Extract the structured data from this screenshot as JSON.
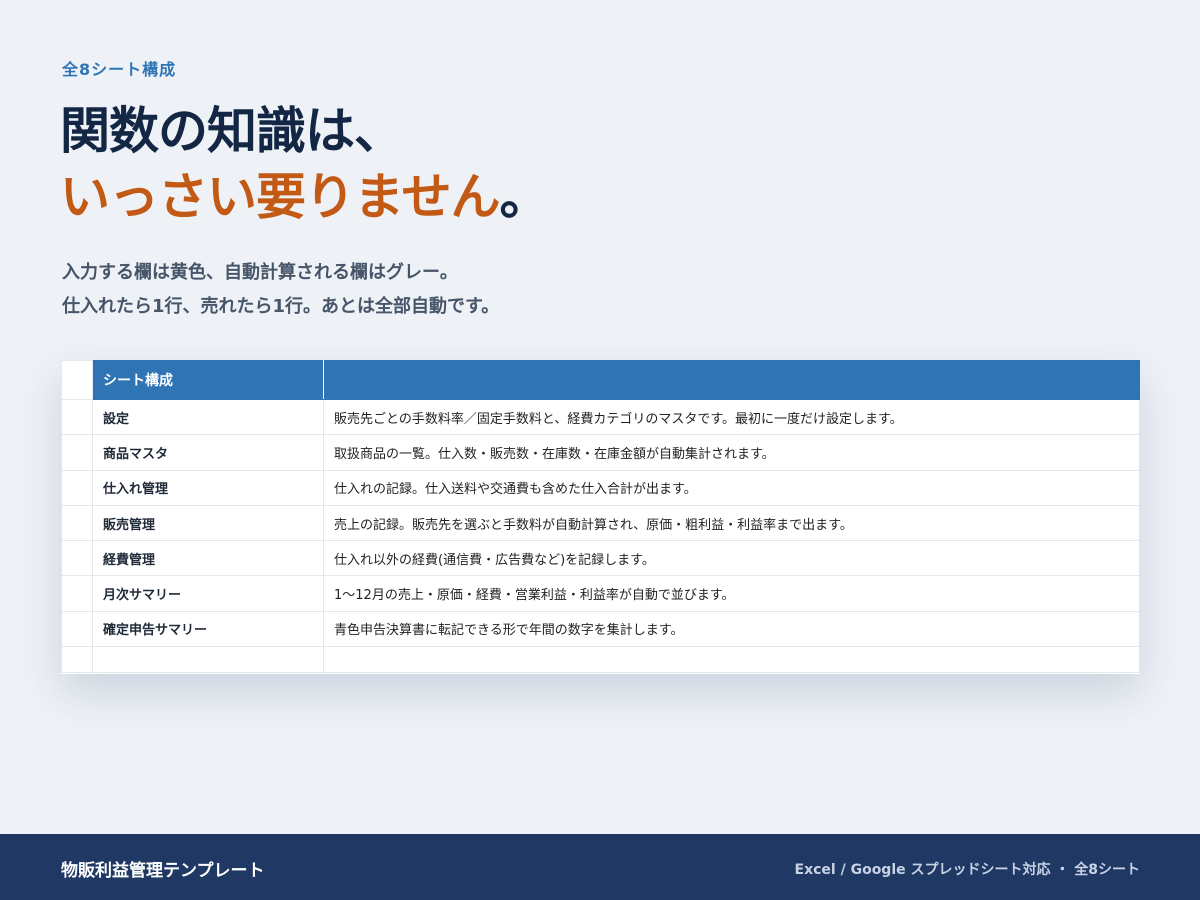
{
  "eyebrow": "全8シート構成",
  "headline": {
    "line1": "関数の知識は、",
    "line2_accent": "いっさい要りません",
    "line2_punct": "。"
  },
  "lead": {
    "line1": "入力する欄は黄色、自動計算される欄はグレー。",
    "line2": "仕入れたら1行、売れたら1行。あとは全部自動です。"
  },
  "sheet": {
    "header": "シート構成",
    "header_desc": "",
    "rows": [
      {
        "name": "設定",
        "desc": "販売先ごとの手数料率／固定手数料と、経費カテゴリのマスタです。最初に一度だけ設定します。"
      },
      {
        "name": "商品マスタ",
        "desc": "取扱商品の一覧。仕入数・販売数・在庫数・在庫金額が自動集計されます。"
      },
      {
        "name": "仕入れ管理",
        "desc": "仕入れの記録。仕入送料や交通費も含めた仕入合計が出ます。"
      },
      {
        "name": "販売管理",
        "desc": "売上の記録。販売先を選ぶと手数料が自動計算され、原価・粗利益・利益率まで出ます。"
      },
      {
        "name": "経費管理",
        "desc": "仕入れ以外の経費(通信費・広告費など)を記録します。"
      },
      {
        "name": "月次サマリー",
        "desc": "1〜12月の売上・原価・経費・営業利益・利益率が自動で並びます。"
      },
      {
        "name": "確定申告サマリー",
        "desc": "青色申告決算書に転記できる形で年間の数字を集計します。"
      }
    ]
  },
  "footer": {
    "brand": "物販利益管理テンプレート",
    "meta": "Excel / Google スプレッドシート対応 ・ 全8シート"
  },
  "colors": {
    "accent_blue": "#2f74b5",
    "accent_orange": "#c25a16",
    "navy": "#1f3864",
    "background": "#eef2f7"
  }
}
